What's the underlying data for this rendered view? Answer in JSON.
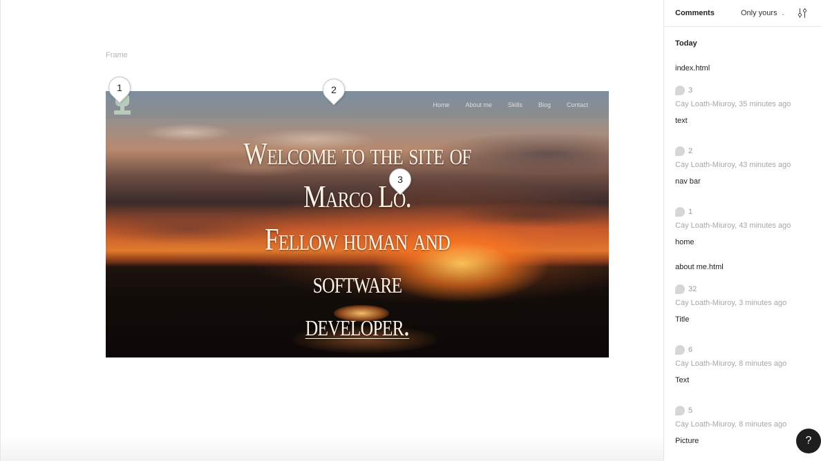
{
  "canvas": {
    "frame_label": "Frame",
    "site": {
      "nav_links": [
        "Home",
        "About me",
        "Skills",
        "Blog",
        "Contact"
      ],
      "hero_lines": [
        "Welcome to the site of Marco Lo.",
        "Fellow human and software",
        "developer."
      ]
    },
    "pins": [
      "1",
      "2",
      "3"
    ]
  },
  "sidebar": {
    "title": "Comments",
    "filter": "Only yours",
    "filter_icon": "filter-sliders-icon",
    "group": "Today",
    "files": [
      {
        "name": "index.html",
        "threads": [
          {
            "number": "3",
            "meta": "Cay Loath-Miuroy, 35 minutes ago",
            "message": "text"
          },
          {
            "number": "2",
            "meta": "Cay Loath-Miuroy, 43 minutes ago",
            "message": "nav bar"
          },
          {
            "number": "1",
            "meta": "Cay Loath-Miuroy, 43 minutes ago",
            "message": "home"
          }
        ]
      },
      {
        "name": "about me.html",
        "threads": [
          {
            "number": "32",
            "meta": "Cay Loath-Miuroy, 3 minutes ago",
            "message": "Title"
          },
          {
            "number": "6",
            "meta": "Cay Loath-Miuroy, 8 minutes ago",
            "message": "Text"
          },
          {
            "number": "5",
            "meta": "Cay Loath-Miuroy, 8 minutes ago",
            "message": "Picture"
          }
        ]
      }
    ]
  },
  "help": {
    "label": "?"
  }
}
